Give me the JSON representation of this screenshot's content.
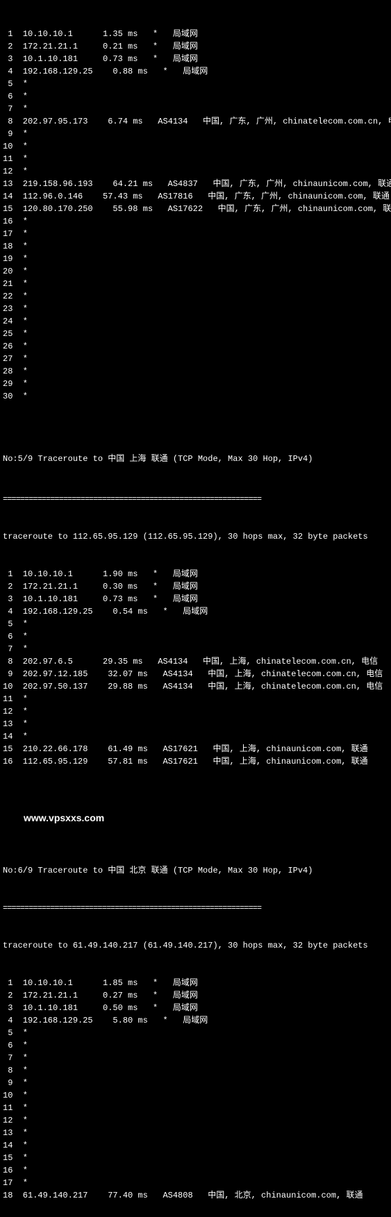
{
  "section1": {
    "hops": [
      {
        "n": " 1",
        "ip": "10.10.10.1    ",
        "ms": "1.35 ms ",
        "asn": " *  ",
        "loc": "局域网"
      },
      {
        "n": " 2",
        "ip": "172.21.21.1   ",
        "ms": "0.21 ms ",
        "asn": " *  ",
        "loc": "局域网"
      },
      {
        "n": " 3",
        "ip": "10.1.10.181   ",
        "ms": "0.73 ms ",
        "asn": " *  ",
        "loc": "局域网"
      },
      {
        "n": " 4",
        "ip": "192.168.129.25",
        "ms": "  0.88 ms",
        "asn": "  * ",
        "loc": " 局域网"
      },
      {
        "n": " 5",
        "ip": "*"
      },
      {
        "n": " 6",
        "ip": "*"
      },
      {
        "n": " 7",
        "ip": "*"
      },
      {
        "n": " 8",
        "ip": "202.97.95.173 ",
        "ms": " 6.74 ms",
        "asn": "  AS4134 ",
        "loc": " 中国, 广东, 广州, chinatelecom.com.cn, 电信"
      },
      {
        "n": " 9",
        "ip": "*"
      },
      {
        "n": "10",
        "ip": "*"
      },
      {
        "n": "11",
        "ip": "*"
      },
      {
        "n": "12",
        "ip": "*"
      },
      {
        "n": "13",
        "ip": "219.158.96.193",
        "ms": "  64.21 ms",
        "asn": "  AS4837 ",
        "loc": " 中国, 广东, 广州, chinaunicom.com, 联通"
      },
      {
        "n": "14",
        "ip": "112.96.0.146  ",
        "ms": "57.43 ms",
        "asn": "  AS17816 ",
        "loc": " 中国, 广东, 广州, chinaunicom.com, 联通"
      },
      {
        "n": "15",
        "ip": "120.80.170.250",
        "ms": "  55.98 ms",
        "asn": "  AS17622 ",
        "loc": " 中国, 广东, 广州, chinaunicom.com, 联通"
      },
      {
        "n": "16",
        "ip": "*"
      },
      {
        "n": "17",
        "ip": "*"
      },
      {
        "n": "18",
        "ip": "*"
      },
      {
        "n": "19",
        "ip": "*"
      },
      {
        "n": "20",
        "ip": "*"
      },
      {
        "n": "21",
        "ip": "*"
      },
      {
        "n": "22",
        "ip": "*"
      },
      {
        "n": "23",
        "ip": "*"
      },
      {
        "n": "24",
        "ip": "*"
      },
      {
        "n": "25",
        "ip": "*"
      },
      {
        "n": "26",
        "ip": "*"
      },
      {
        "n": "27",
        "ip": "*"
      },
      {
        "n": "28",
        "ip": "*"
      },
      {
        "n": "29",
        "ip": "*"
      },
      {
        "n": "30",
        "ip": "*"
      }
    ]
  },
  "section2": {
    "header": "No:5/9 Traceroute to 中国 上海 联通 (TCP Mode, Max 30 Hop, IPv4)",
    "divider": "============================================================",
    "trace_to": "traceroute to 112.65.95.129 (112.65.95.129), 30 hops max, 32 byte packets",
    "hops": [
      {
        "n": " 1",
        "ip": "10.10.10.1    ",
        "ms": "1.90 ms ",
        "asn": " *  ",
        "loc": "局域网"
      },
      {
        "n": " 2",
        "ip": "172.21.21.1   ",
        "ms": "0.30 ms ",
        "asn": " *  ",
        "loc": "局域网"
      },
      {
        "n": " 3",
        "ip": "10.1.10.181   ",
        "ms": "0.73 ms ",
        "asn": " *  ",
        "loc": "局域网"
      },
      {
        "n": " 4",
        "ip": "192.168.129.25",
        "ms": "  0.54 ms",
        "asn": "  * ",
        "loc": " 局域网"
      },
      {
        "n": " 5",
        "ip": "*"
      },
      {
        "n": " 6",
        "ip": "*"
      },
      {
        "n": " 7",
        "ip": "*"
      },
      {
        "n": " 8",
        "ip": "202.97.6.5    ",
        "ms": "29.35 ms",
        "asn": "  AS4134 ",
        "loc": " 中国, 上海, chinatelecom.com.cn, 电信"
      },
      {
        "n": " 9",
        "ip": "202.97.12.185 ",
        "ms": " 32.07 ms",
        "asn": "  AS4134 ",
        "loc": " 中国, 上海, chinatelecom.com.cn, 电信"
      },
      {
        "n": "10",
        "ip": "202.97.50.137 ",
        "ms": " 29.88 ms",
        "asn": "  AS4134 ",
        "loc": " 中国, 上海, chinatelecom.com.cn, 电信"
      },
      {
        "n": "11",
        "ip": "*"
      },
      {
        "n": "12",
        "ip": "*"
      },
      {
        "n": "13",
        "ip": "*"
      },
      {
        "n": "14",
        "ip": "*"
      },
      {
        "n": "15",
        "ip": "210.22.66.178 ",
        "ms": " 61.49 ms",
        "asn": "  AS17621 ",
        "loc": " 中国, 上海, chinaunicom.com, 联通"
      },
      {
        "n": "16",
        "ip": "112.65.95.129 ",
        "ms": " 57.81 ms",
        "asn": "  AS17621 ",
        "loc": " 中国, 上海, chinaunicom.com, 联通"
      }
    ]
  },
  "watermark": "www.vpsxxs.com",
  "section3": {
    "header": "No:6/9 Traceroute to 中国 北京 联通 (TCP Mode, Max 30 Hop, IPv4)",
    "divider": "============================================================",
    "trace_to": "traceroute to 61.49.140.217 (61.49.140.217), 30 hops max, 32 byte packets",
    "hops": [
      {
        "n": " 1",
        "ip": "10.10.10.1    ",
        "ms": "1.85 ms ",
        "asn": " *  ",
        "loc": "局域网"
      },
      {
        "n": " 2",
        "ip": "172.21.21.1   ",
        "ms": "0.27 ms ",
        "asn": " *  ",
        "loc": "局域网"
      },
      {
        "n": " 3",
        "ip": "10.1.10.181   ",
        "ms": "0.50 ms ",
        "asn": " *  ",
        "loc": "局域网"
      },
      {
        "n": " 4",
        "ip": "192.168.129.25",
        "ms": "  5.80 ms",
        "asn": "  * ",
        "loc": " 局域网"
      },
      {
        "n": " 5",
        "ip": "*"
      },
      {
        "n": " 6",
        "ip": "*"
      },
      {
        "n": " 7",
        "ip": "*"
      },
      {
        "n": " 8",
        "ip": "*"
      },
      {
        "n": " 9",
        "ip": "*"
      },
      {
        "n": "10",
        "ip": "*"
      },
      {
        "n": "11",
        "ip": "*"
      },
      {
        "n": "12",
        "ip": "*"
      },
      {
        "n": "13",
        "ip": "*"
      },
      {
        "n": "14",
        "ip": "*"
      },
      {
        "n": "15",
        "ip": "*"
      },
      {
        "n": "16",
        "ip": "*"
      },
      {
        "n": "17",
        "ip": "*"
      },
      {
        "n": "18",
        "ip": "61.49.140.217 ",
        "ms": " 77.40 ms",
        "asn": "  AS4808 ",
        "loc": " 中国, 北京, chinaunicom.com, 联通"
      }
    ]
  }
}
